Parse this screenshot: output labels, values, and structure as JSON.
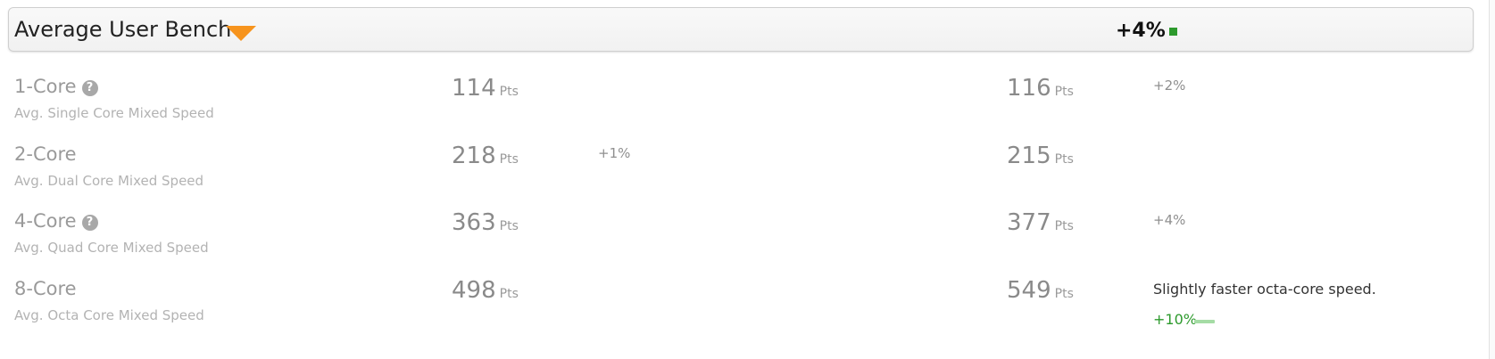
{
  "header": {
    "title": "Average User Bench",
    "overall_delta": "+4%",
    "dropdown_icon": "triangle-down-icon",
    "accent_color": "#f7941d",
    "indicator_color": "#2d9a2d"
  },
  "rows": [
    {
      "label": "1-Core",
      "has_help": true,
      "help_glyph": "?",
      "sub_label": "Avg. Single Core Mixed Speed",
      "left_score": "114",
      "left_unit": "Pts",
      "left_delta": "",
      "right_score": "116",
      "right_unit": "Pts",
      "right_delta": "+2%"
    },
    {
      "label": "2-Core",
      "has_help": false,
      "help_glyph": "",
      "sub_label": "Avg. Dual Core Mixed Speed",
      "left_score": "218",
      "left_unit": "Pts",
      "left_delta": "+1%",
      "right_score": "215",
      "right_unit": "Pts",
      "right_delta": ""
    },
    {
      "label": "4-Core",
      "has_help": true,
      "help_glyph": "?",
      "sub_label": "Avg. Quad Core Mixed Speed",
      "left_score": "363",
      "left_unit": "Pts",
      "left_delta": "",
      "right_score": "377",
      "right_unit": "Pts",
      "right_delta": "+4%"
    },
    {
      "label": "8-Core",
      "has_help": false,
      "help_glyph": "",
      "sub_label": "Avg. Octa Core Mixed Speed",
      "left_score": "498",
      "left_unit": "Pts",
      "left_delta": "",
      "right_score": "549",
      "right_unit": "Pts",
      "right_delta": "",
      "note": "Slightly faster octa-core speed.",
      "note_delta": "+10%"
    }
  ]
}
